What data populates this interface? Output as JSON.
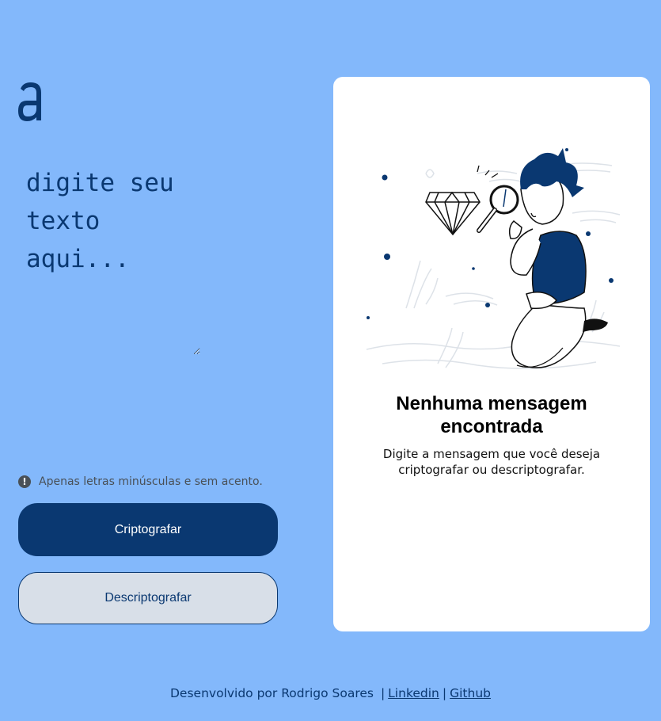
{
  "logo": {
    "glyph": "a",
    "icon": "alura-logo-icon"
  },
  "input": {
    "placeholder": "digite seu texto aqui...",
    "value": ""
  },
  "hint": {
    "icon": "info-icon",
    "text": "Apenas letras minúsculas e sem acento."
  },
  "buttons": {
    "encrypt": "Criptografar",
    "decrypt": "Descriptografar"
  },
  "output": {
    "title": "Nenhuma mensagem encontrada",
    "text": "Digite a mensagem que você deseja criptografar ou descriptografar.",
    "illustration": "person-with-magnifying-glass-illustration"
  },
  "footer": {
    "credit": "Desenvolvido por Rodrigo Soares",
    "separator": "|",
    "linkedin": "Linkedin",
    "github": "Github"
  },
  "colors": {
    "background": "#83b8fb",
    "primary": "#0a3871",
    "secondary_button": "#d8dfe8",
    "card": "#ffffff",
    "hint": "#495057"
  }
}
